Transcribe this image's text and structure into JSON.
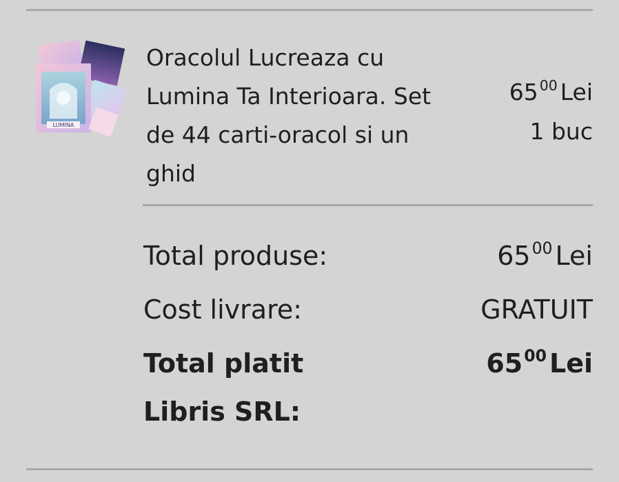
{
  "product": {
    "thumbnail_icon": "book-cover-image",
    "thumbnail_text": "LUMINA",
    "name": "Oracolul Lucreaza cu Lumina Ta Interioara. Set de 44 carti-oracol si un ghid",
    "price_int": "65",
    "price_dec": "00",
    "currency": "Lei",
    "quantity": "1 buc"
  },
  "summary": {
    "total_products_label": "Total produse:",
    "total_products_int": "65",
    "total_products_dec": "00",
    "total_products_currency": "Lei",
    "shipping_label": "Cost livrare:",
    "shipping_value": "GRATUIT",
    "total_paid_label": "Total platit",
    "total_paid_int": "65",
    "total_paid_dec": "00",
    "total_paid_currency": "Lei",
    "seller": "Libris SRL:"
  },
  "colors": {
    "background": "#d4d4d4",
    "divider": "#a9a9a9",
    "text": "#1f1f1f"
  }
}
